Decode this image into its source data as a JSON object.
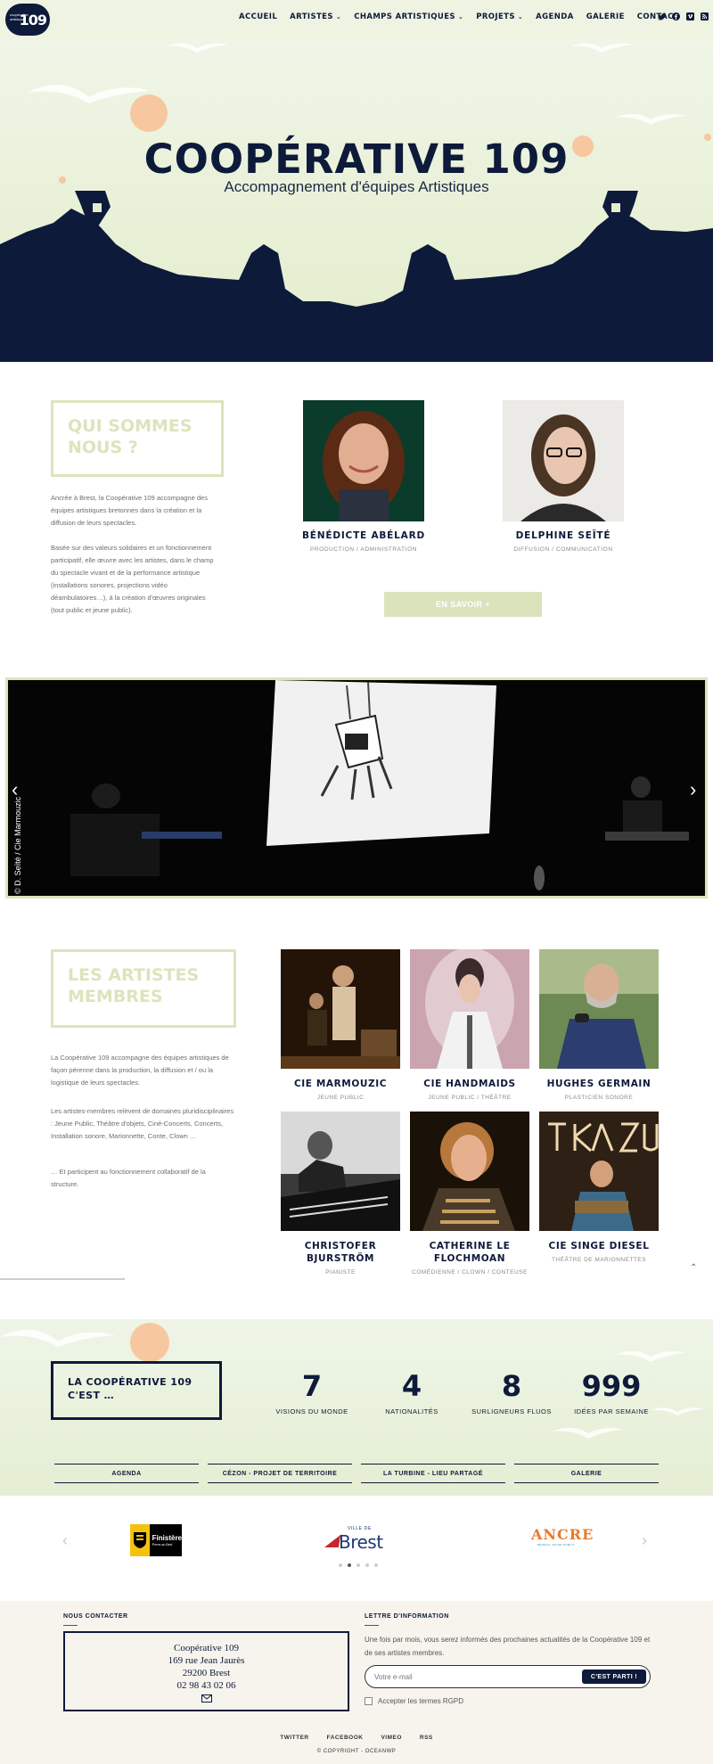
{
  "header": {
    "logo_small": "coopérative artistique",
    "logo_num": "109",
    "nav": [
      {
        "label": "ACCUEIL",
        "caret": false
      },
      {
        "label": "ARTISTES",
        "caret": true
      },
      {
        "label": "CHAMPS ARTISTIQUES",
        "caret": true
      },
      {
        "label": "PROJETS",
        "caret": true
      },
      {
        "label": "AGENDA",
        "caret": false
      },
      {
        "label": "GALERIE",
        "caret": false
      },
      {
        "label": "CONTACT",
        "caret": false
      }
    ],
    "social_icons": [
      "twitter-icon",
      "facebook-icon",
      "vimeo-icon",
      "rss-icon"
    ]
  },
  "hero": {
    "title": "COOPÉRATIVE 109",
    "subtitle": "Accompagnement d'équipes Artistiques"
  },
  "about": {
    "title": "QUI SOMMES NOUS ?",
    "para1": "Ancrée à Brest, la Coopérative 109 accompagne des équipes artistiques bretonnes dans la création et la diffusion de leurs spectacles.",
    "para2": "Basée sur des valeurs solidaires et un fonctionnement participatif, elle œuvre avec les artistes, dans le champ du spectacle vivant et de la performance artistique (installations sonores, projections vidéo déambulatoires…), à la création d'œuvres originales (tout public et jeune public).",
    "people": [
      {
        "name": "BÉNÉDICTE ABÉLARD",
        "role": "PRODUCTION / ADMINISTRATION"
      },
      {
        "name": "DELPHINE SEÏTÉ",
        "role": "DIFFUSION / COMMUNICATION"
      }
    ],
    "more_label": "EN SAVOIR +"
  },
  "slider": {
    "credit": "© D. Seïté / Cie Marmouzic"
  },
  "artists": {
    "title": "LES ARTISTES MEMBRES",
    "para1": "La Coopérative 109 accompagne des équipes artistiques de façon pérenne dans la production, la diffusion et / ou la logistique de leurs spectacles.",
    "para2": "Les artistes-membres relèvent de domaines pluridisciplinaires : Jeune Public, Théâtre d'objets, Ciné-Concerts, Concerts, Installation sonore, Marionnette, Conte, Clown …",
    "para3": "… Et participent au fonctionnement collaboratif de la structure.",
    "items": [
      {
        "name": "CIE MARMOUZIC",
        "role": "JEUNE PUBLIC"
      },
      {
        "name": "CIE HANDMAIDS",
        "role": "JEUNE PUBLIC / THÉÂTRE"
      },
      {
        "name": "HUGHES GERMAIN",
        "role": "PLASTICIEN SONORE"
      },
      {
        "name": "CHRISTOFER BJURSTRÖM",
        "role": "PIANISTE"
      },
      {
        "name": "CATHERINE LE FLOCHMOAN",
        "role": "COMÉDIENNE / CLOWN / CONTEUSE"
      },
      {
        "name": "CIE SINGE DIESEL",
        "role": "THÉÂTRE DE MARIONNETTES"
      }
    ]
  },
  "stats": {
    "box": "LA COOPÉRATIVE 109 C'EST …",
    "items": [
      {
        "num": "7",
        "label": "VISIONS DU MONDE"
      },
      {
        "num": "4",
        "label": "NATIONALITÉS"
      },
      {
        "num": "8",
        "label": "SURLIGNEURS FLUOS"
      },
      {
        "num": "999",
        "label": "IDÉES PAR SEMAINE"
      }
    ],
    "links": [
      "AGENDA",
      "CÉZON - PROJET DE TERRITOIRE",
      "LA TURBINE - LIEU PARTAGÉ",
      "GALERIE"
    ]
  },
  "partners": {
    "finistere": "Finistère",
    "finistere_sub": "Penn-ar-Bed",
    "ville_de": "VILLE DE",
    "brest": "Brest",
    "ancre": "ANCRE",
    "ancre_sub": "RÉSEAU JEUNE PUBLIC",
    "active_dot": 1,
    "dot_count": 5
  },
  "footer": {
    "contact_heading": "NOUS CONTACTER",
    "contact_lines": [
      "Coopérative 109",
      "169 rue Jean Jaurès",
      "29200 Brest",
      "02 98 43 02 06"
    ],
    "news_heading": "LETTRE D'INFORMATION",
    "news_text": "Une fois par mois, vous serez informés des prochaines actualités de la Coopérative 109 et de ses artistes membres.",
    "email_placeholder": "Votre e-mail",
    "submit_label": "C'EST PARTI !",
    "rgpd_label": "Accepter les termes RGPD",
    "links": [
      "TWITTER",
      "FACEBOOK",
      "VIMEO",
      "RSS"
    ],
    "copyright": "© COPYRIGHT - OCEANWP"
  },
  "colors": {
    "navy": "#0d1a3a",
    "sage": "#dce4bd",
    "peach": "#f7c7a0",
    "hero_bg": "#e7efd3"
  }
}
